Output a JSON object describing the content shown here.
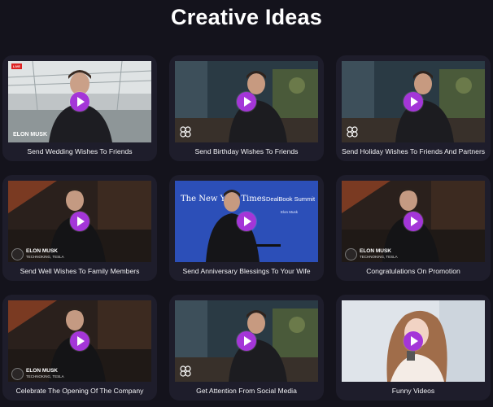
{
  "page": {
    "title": "Creative Ideas"
  },
  "accent_colors": {
    "play": "#a436d8",
    "card": "#1e1d2b",
    "background": "#14131c"
  },
  "cards": [
    {
      "label": "Send Wedding Wishes To Friends",
      "overlay_name": "ELON MUSK",
      "live_badge": "LIVE"
    },
    {
      "label": "Send Birthday Wishes To Friends"
    },
    {
      "label": "Send Holiday Wishes To Friends And Partners"
    },
    {
      "label": "Send Well Wishes To Family Members",
      "overlay_name": "ELON MUSK",
      "overlay_sub": "TECHNOKING, TESLA"
    },
    {
      "label": "Send Anniversary Blessings To Your Wife",
      "masthead": "The New York Times",
      "event": "DealBook Summit",
      "speaker": "Elon Musk"
    },
    {
      "label": "Congratulations On Promotion",
      "overlay_name": "ELON MUSK",
      "overlay_sub": "TECHNOKING, TESLA"
    },
    {
      "label": "Celebrate The Opening Of The Company",
      "overlay_name": "ELON MUSK",
      "overlay_sub": "TECHNOKING, TESLA"
    },
    {
      "label": "Get Attention From Social Media"
    },
    {
      "label": "Funny Videos"
    }
  ],
  "icons": {
    "play": "play-button-icon"
  }
}
